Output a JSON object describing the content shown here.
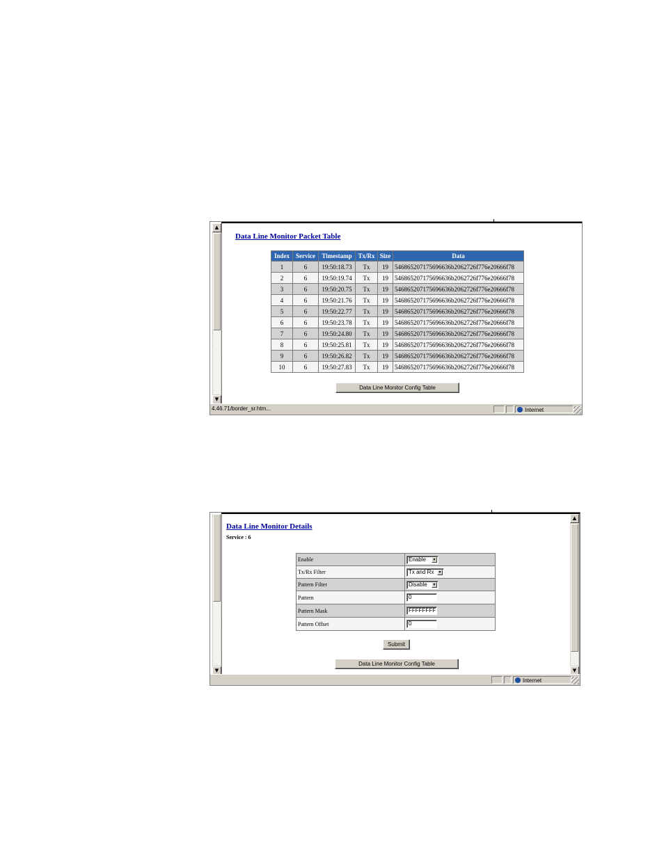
{
  "packet_window": {
    "title": "Data Line Monitor Packet Table",
    "columns": [
      "Index",
      "Service",
      "Timestamp",
      "Tx/Rx",
      "Size",
      "Data"
    ],
    "rows": [
      {
        "index": "1",
        "service": "6",
        "timestamp": "19:50:18.73",
        "txrx": "Tx",
        "size": "19",
        "data": "546865207175696636b2062726f776e20666f78"
      },
      {
        "index": "2",
        "service": "6",
        "timestamp": "19:50:19.74",
        "txrx": "Tx",
        "size": "19",
        "data": "546865207175696636b2062726f776e20666f78"
      },
      {
        "index": "3",
        "service": "6",
        "timestamp": "19:50:20.75",
        "txrx": "Tx",
        "size": "19",
        "data": "546865207175696636b2062726f776e20666f78"
      },
      {
        "index": "4",
        "service": "6",
        "timestamp": "19:50:21.76",
        "txrx": "Tx",
        "size": "19",
        "data": "546865207175696636b2062726f776e20666f78"
      },
      {
        "index": "5",
        "service": "6",
        "timestamp": "19:50:22.77",
        "txrx": "Tx",
        "size": "19",
        "data": "546865207175696636b2062726f776e20666f78"
      },
      {
        "index": "6",
        "service": "6",
        "timestamp": "19:50:23.78",
        "txrx": "Tx",
        "size": "19",
        "data": "546865207175696636b2062726f776e20666f78"
      },
      {
        "index": "7",
        "service": "6",
        "timestamp": "19:50:24.80",
        "txrx": "Tx",
        "size": "19",
        "data": "546865207175696636b2062726f776e20666f78"
      },
      {
        "index": "8",
        "service": "6",
        "timestamp": "19:50:25.81",
        "txrx": "Tx",
        "size": "19",
        "data": "546865207175696636b2062726f776e20666f78"
      },
      {
        "index": "9",
        "service": "6",
        "timestamp": "19:50:26.82",
        "txrx": "Tx",
        "size": "19",
        "data": "546865207175696636b2062726f776e20666f78"
      },
      {
        "index": "10",
        "service": "6",
        "timestamp": "19:50:27.83",
        "txrx": "Tx",
        "size": "19",
        "data": "546865207175696636b2062726f776e20666f78"
      }
    ],
    "config_button": "Data Line Monitor Config Table",
    "status_url": "4.46.71/border_sr.htm...",
    "status_zone": "Internet"
  },
  "details_window": {
    "title": "Data Line Monitor Details",
    "service_label": "Service : 6",
    "fields": {
      "enable": {
        "label": "Enable",
        "value": "Enable"
      },
      "txrx_filter": {
        "label": "Tx/Rx Filter",
        "value": "Tx and Rx"
      },
      "pattern_filter": {
        "label": "Pattern Filter",
        "value": "Disable"
      },
      "pattern": {
        "label": "Pattern",
        "value": "0"
      },
      "pattern_mask": {
        "label": "Pattern Mask",
        "value": "FFFFFFFF"
      },
      "pattern_offset": {
        "label": "Pattern Offset",
        "value": "0"
      }
    },
    "submit_button": "Submit",
    "config_button": "Data Line Monitor Config Table",
    "status_zone": "Internet"
  },
  "colors": {
    "header_blue": "#2f66b0",
    "link_blue": "#00009c",
    "row_dark": "#d2d2d2",
    "row_light": "#f4f4f4",
    "chrome_gray": "#d4d0c8"
  }
}
